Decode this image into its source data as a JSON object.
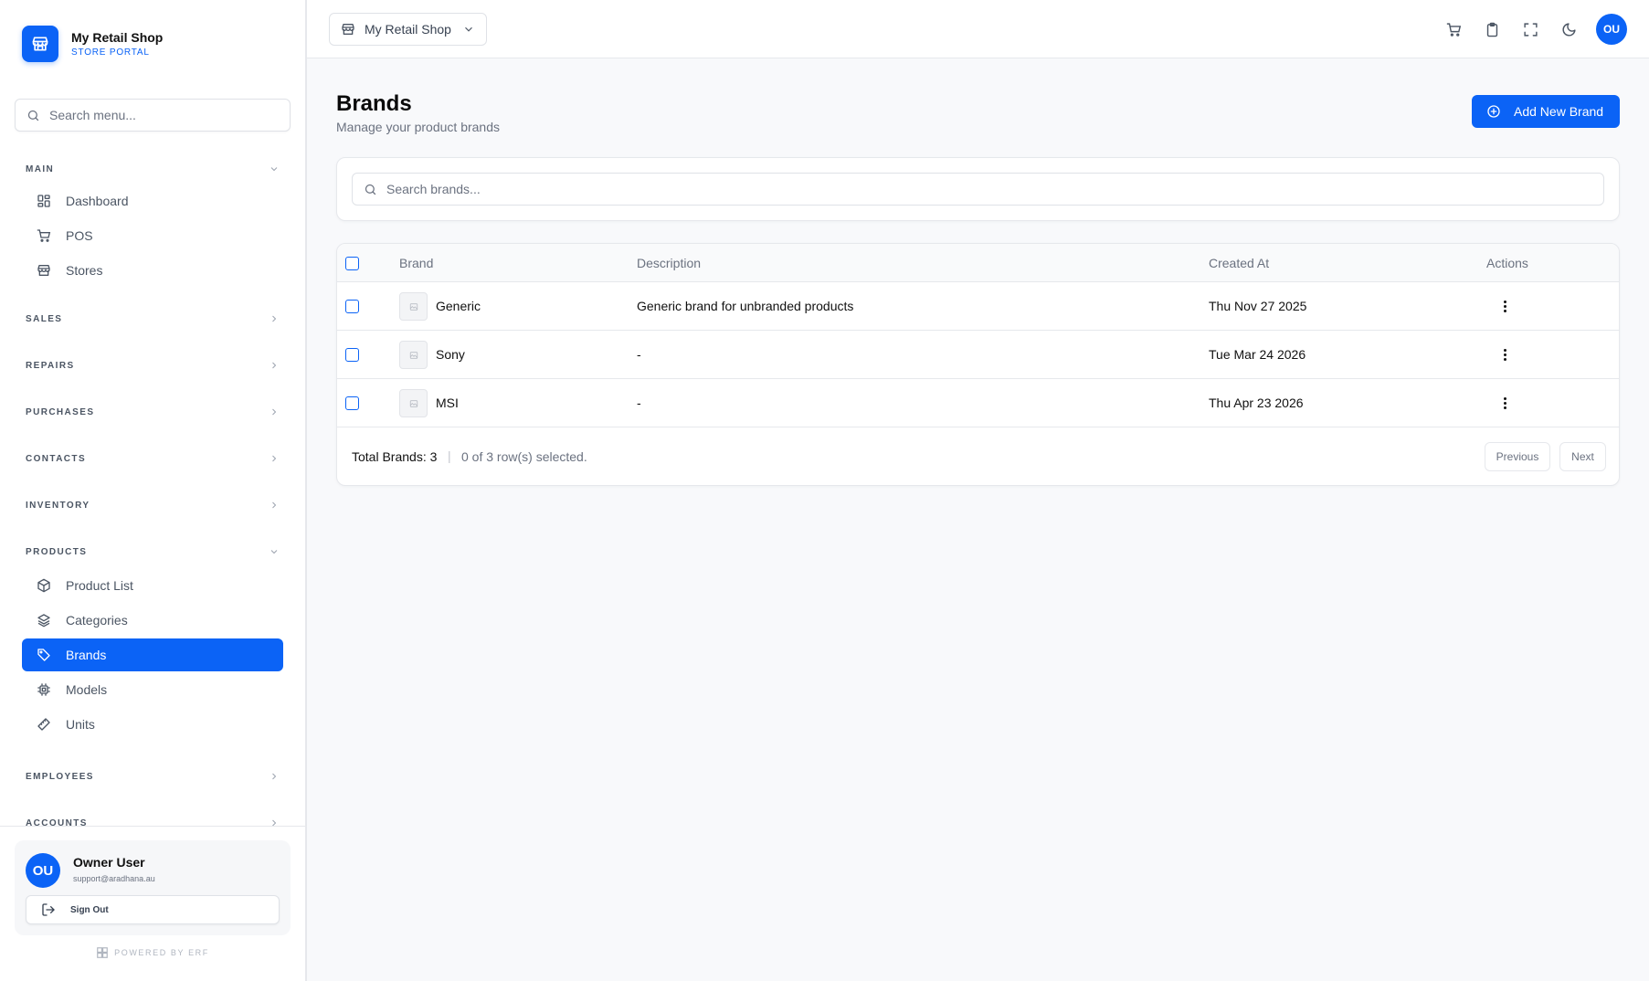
{
  "app": {
    "name": "My Retail Shop",
    "subtitle": "STORE PORTAL"
  },
  "sidebar": {
    "search_placeholder": "Search menu...",
    "sections": {
      "main": {
        "label": "MAIN",
        "items": [
          "Dashboard",
          "POS",
          "Stores"
        ]
      },
      "sales": "SALES",
      "repairs": "REPAIRS",
      "purchases": "PURCHASES",
      "contacts": "CONTACTS",
      "inventory": "INVENTORY",
      "products": {
        "label": "PRODUCTS",
        "items": [
          "Product List",
          "Categories",
          "Brands",
          "Models",
          "Units"
        ]
      },
      "employees": "EMPLOYEES",
      "accounts": "ACCOUNTS"
    },
    "active_item": "Brands"
  },
  "user": {
    "initials": "OU",
    "name": "Owner User",
    "email": "support@aradhana.au",
    "sign_out": "Sign Out"
  },
  "footer": {
    "powered": "POWERED BY ERF"
  },
  "topbar": {
    "store": "My Retail Shop",
    "avatar": "OU",
    "icons": [
      "cart-icon",
      "clipboard-icon",
      "fullscreen-icon",
      "moon-icon"
    ]
  },
  "page": {
    "title": "Brands",
    "subtitle": "Manage your product brands",
    "add_button": "Add New Brand",
    "search_placeholder": "Search brands..."
  },
  "table": {
    "headers": {
      "brand": "Brand",
      "description": "Description",
      "created": "Created At",
      "actions": "Actions"
    },
    "rows": [
      {
        "brand": "Generic",
        "description": "Generic brand for unbranded products",
        "created": "Thu Nov 27 2025"
      },
      {
        "brand": "Sony",
        "description": "-",
        "created": "Tue Mar 24 2026"
      },
      {
        "brand": "MSI",
        "description": "-",
        "created": "Thu Apr 23 2026"
      }
    ],
    "total": "Total Brands: 3",
    "selected": "0 of 3 row(s) selected.",
    "prev": "Previous",
    "next": "Next"
  },
  "colors": {
    "accent": "#0b63f6",
    "background": "#f8f9fb",
    "muted_text": "#6b7280"
  }
}
